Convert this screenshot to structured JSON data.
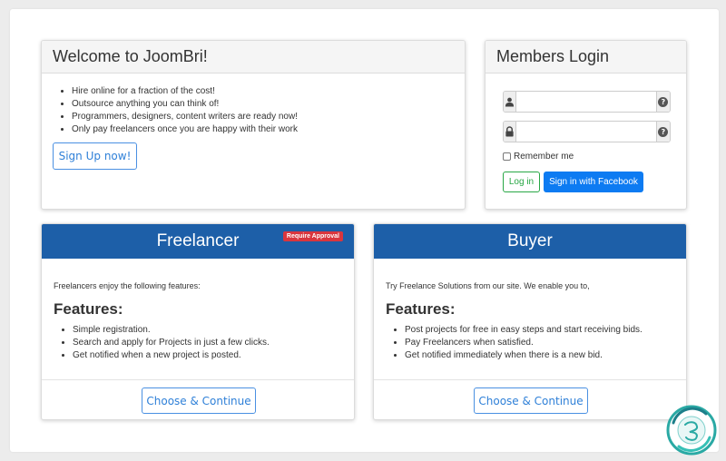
{
  "welcome": {
    "title": "Welcome to JoomBri!",
    "bullets": [
      "Hire online for a fraction of the cost!",
      "Outsource anything you can think of!",
      "Programmers, designers, content writers are ready now!",
      "Only pay freelancers once you are happy with their work"
    ],
    "signup_label": "Sign Up now!"
  },
  "login": {
    "title": "Members Login",
    "username_value": "",
    "password_value": "",
    "remember_label": "Remember me",
    "login_label": "Log in",
    "facebook_label": "Sign in with Facebook",
    "icons": [
      "user-icon",
      "question-icon",
      "lock-icon",
      "question-icon"
    ]
  },
  "freelancer": {
    "title": "Freelancer",
    "badge": "Require Approval",
    "intro": "Freelancers enjoy the following features:",
    "features_title": "Features:",
    "features": [
      "Simple registration.",
      "Search and apply for Projects in just a few clicks.",
      "Get notified when a new project is posted."
    ],
    "button_label": "Choose & Continue"
  },
  "buyer": {
    "title": "Buyer",
    "intro": "Try Freelance Solutions from our site. We enable you to,",
    "features_title": "Features:",
    "features": [
      "Post projects for free in easy steps and start receiving bids.",
      "Pay Freelancers when satisfied.",
      "Get notified immediately when there is a new bid."
    ],
    "button_label": "Choose & Continue"
  },
  "colors": {
    "plan_header": "#1d5fa8",
    "primary": "#0d7bf2",
    "success": "#28a745",
    "danger": "#d9363e",
    "logo_teal": "#2aa9a4"
  }
}
